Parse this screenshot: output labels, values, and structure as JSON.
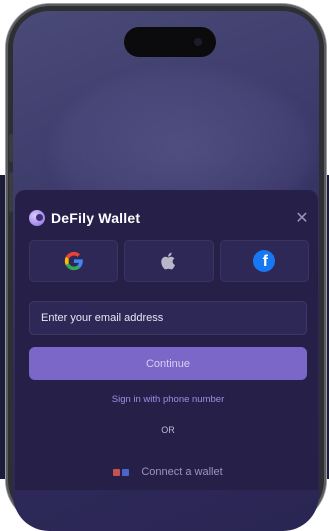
{
  "sheet": {
    "title": "DeFily Wallet",
    "close_icon": "close-icon"
  },
  "social": {
    "buttons": [
      {
        "icon": "google-icon"
      },
      {
        "icon": "apple-icon"
      },
      {
        "icon": "facebook-icon",
        "glyph": "f"
      }
    ]
  },
  "form": {
    "email_placeholder": "Enter your email address",
    "continue_label": "Continue",
    "phone_link": "Sign in with phone number",
    "or_label": "OR",
    "connect_label": "Connect a wallet"
  },
  "colors": {
    "accent": "#7a67c7",
    "sheet_bg": "#262049",
    "link": "#9f8de6"
  }
}
